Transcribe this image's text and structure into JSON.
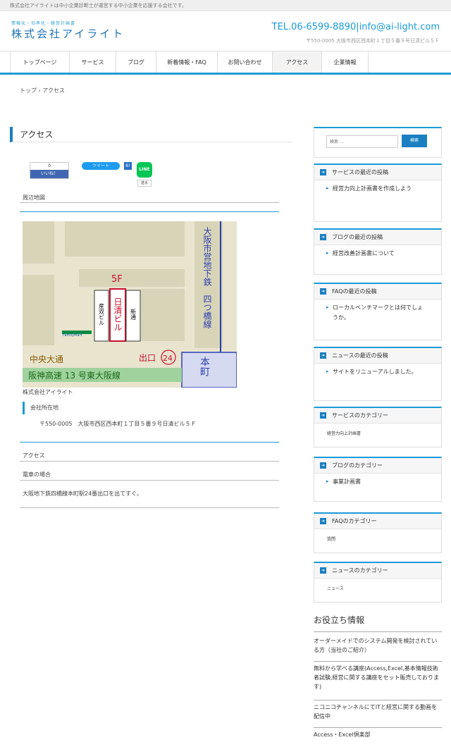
{
  "topbar": {
    "text": "株式会社アイライトは中小企業診断士が運営する中小企業を応援する会社です。"
  },
  "header": {
    "tagline": "情報化・効率化・経営計画書",
    "logo": "株式会社アイライト",
    "contact": "TEL.06-6599-8890|info@ai-light.com",
    "address": "〒550-0005 大阪市西区西本町１丁目５番９号日清ビル５Ｆ"
  },
  "nav": {
    "items": [
      {
        "label": "トップページ",
        "active": false
      },
      {
        "label": "サービス",
        "active": false
      },
      {
        "label": "ブログ",
        "active": false
      },
      {
        "label": "新着情報・FAQ",
        "active": false
      },
      {
        "label": "お問い合わせ",
        "active": false
      },
      {
        "label": "アクセス",
        "active": true
      },
      {
        "label": "企業情報",
        "active": false
      }
    ]
  },
  "breadcrumb": "トップ › アクセス",
  "page": {
    "title": "アクセス"
  },
  "share": {
    "fb_count": "0",
    "fb_like": "いいね！",
    "tweet": "ツイート",
    "hatena": "B!",
    "line": "LINE",
    "line_send": "送る"
  },
  "content": {
    "map_heading": "周辺地図",
    "map": {
      "floor": "5F",
      "building1": "産双ビル",
      "building2": "日清ビル",
      "building3": "新通",
      "familymart": "FamilyMart",
      "line": "大阪市営地下鉄　四つ橋線",
      "street": "中央大通",
      "exit": "出口",
      "exit_no": "24",
      "highway": "阪神高速 13 号東大阪線",
      "station": "本町"
    },
    "company": "株式会社アイライト",
    "address_label": "会社所在地",
    "address_value": "〒550-0005　大阪市西区西本町１丁目５番９号日清ビル５Ｆ",
    "access_heading": "アクセス",
    "train_heading": "電車の場合",
    "train_text": "大阪地下鉄四橋線本町駅24番出口を出てすぐ。"
  },
  "sidebar": {
    "search_placeholder": "検索 …",
    "search_button": "検索",
    "widgets": [
      {
        "title": "サービスの最近の投稿",
        "items": [
          "経営力向上計画書を作成しよう"
        ]
      },
      {
        "title": "ブログの最近の投稿",
        "items": [
          "経営改善計画書について"
        ]
      },
      {
        "title": "FAQの最近の投稿",
        "items": [
          "ローカルベンチマークとは何でしょうか。"
        ]
      },
      {
        "title": "ニュースの最近の投稿",
        "items": [
          "サイトをリニューアルしました。"
        ]
      },
      {
        "title": "サービスのカテゴリー",
        "small": "経営力向上計画書"
      },
      {
        "title": "ブログのカテゴリー",
        "items": [
          "事業計画書"
        ]
      },
      {
        "title": "FAQのカテゴリー",
        "small": "質問"
      },
      {
        "title": "ニュースのカテゴリー",
        "small": "ニュース"
      }
    ],
    "useful_title": "お役立ち情報",
    "useful_links": [
      "オーダーメイドでのシステム開発を検討されている方（当社のご紹介）",
      "無料から学べる講座(Access,Excel,基本情報技術者試験,経営に関する講座をセット販売しております)",
      "ニコニコチャンネルにてITと経営に関する動画を配信中",
      "Access・Excel倶楽部"
    ]
  }
}
